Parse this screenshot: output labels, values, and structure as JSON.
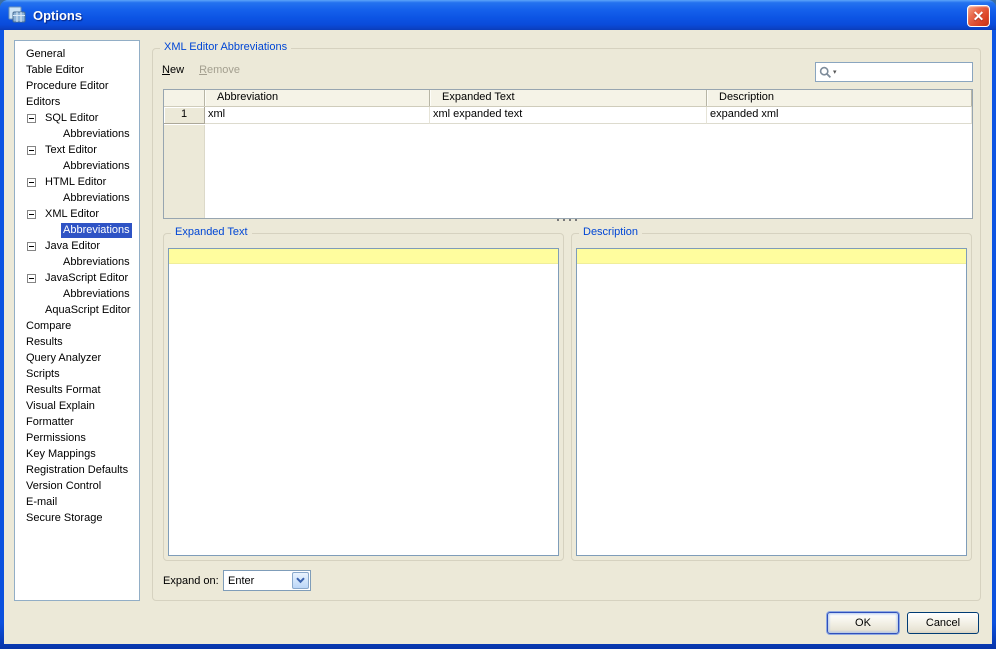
{
  "window": {
    "title": "Options"
  },
  "colors": {
    "titlebar_blue": "#0D55E4",
    "client_bg": "#ECE9D8",
    "selection_blue": "#2E53C5",
    "group_label_blue": "#0046D5",
    "highlight_line_yellow": "#FFFD9E",
    "control_border": "#7F9DB9"
  },
  "sidebar": {
    "items": [
      {
        "label": "General",
        "level": 0
      },
      {
        "label": "Table Editor",
        "level": 0
      },
      {
        "label": "Procedure Editor",
        "level": 0
      },
      {
        "label": "Editors",
        "level": 0
      },
      {
        "label": "SQL Editor",
        "level": 1,
        "toggle": "collapse"
      },
      {
        "label": "Abbreviations",
        "level": 2
      },
      {
        "label": "Text Editor",
        "level": 1,
        "toggle": "collapse"
      },
      {
        "label": "Abbreviations",
        "level": 2
      },
      {
        "label": "HTML Editor",
        "level": 1,
        "toggle": "collapse"
      },
      {
        "label": "Abbreviations",
        "level": 2
      },
      {
        "label": "XML Editor",
        "level": 1,
        "toggle": "collapse"
      },
      {
        "label": "Abbreviations",
        "level": 2,
        "selected": true
      },
      {
        "label": "Java Editor",
        "level": 1,
        "toggle": "collapse"
      },
      {
        "label": "Abbreviations",
        "level": 2
      },
      {
        "label": "JavaScript Editor",
        "level": 1,
        "toggle": "collapse"
      },
      {
        "label": "Abbreviations",
        "level": 2
      },
      {
        "label": "AquaScript Editor",
        "level": 1
      },
      {
        "label": "Compare",
        "level": 0
      },
      {
        "label": "Results",
        "level": 0
      },
      {
        "label": "Query Analyzer",
        "level": 0
      },
      {
        "label": "Scripts",
        "level": 0
      },
      {
        "label": "Results Format",
        "level": 0
      },
      {
        "label": "Visual Explain",
        "level": 0
      },
      {
        "label": "Formatter",
        "level": 0
      },
      {
        "label": "Permissions",
        "level": 0
      },
      {
        "label": "Key Mappings",
        "level": 0
      },
      {
        "label": "Registration Defaults",
        "level": 0
      },
      {
        "label": "Version Control",
        "level": 0
      },
      {
        "label": "E-mail",
        "level": 0
      },
      {
        "label": "Secure Storage",
        "level": 0
      }
    ]
  },
  "main": {
    "group_title": "XML Editor Abbreviations",
    "toolbar": {
      "new_label": "New",
      "remove_label": "Remove"
    },
    "search": {
      "value": "",
      "icon": "magnifier-icon"
    },
    "table": {
      "columns": [
        "",
        "Abbreviation",
        "Expanded Text",
        "Description"
      ],
      "rows": [
        {
          "num": "1",
          "abbreviation": "xml",
          "expanded_text": "xml expanded text",
          "description": "expanded xml"
        }
      ]
    },
    "expanded_text_group": {
      "title": "Expanded Text"
    },
    "description_group": {
      "title": "Description"
    },
    "expand_on": {
      "label": "Expand on:",
      "value": "Enter"
    }
  },
  "footer": {
    "ok_label": "OK",
    "cancel_label": "Cancel"
  }
}
